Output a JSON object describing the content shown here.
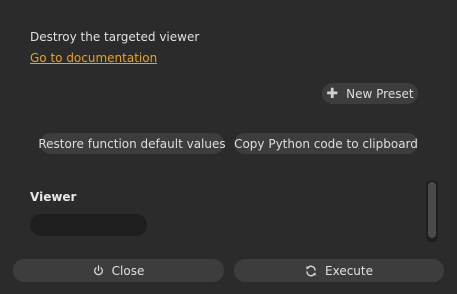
{
  "description": "Destroy the targeted viewer",
  "doc_link": "Go to documentation",
  "presets": {
    "new_label": "New Preset",
    "icon": "plus-icon"
  },
  "actions": {
    "restore_label": "Restore function default values",
    "copy_label": "Copy Python code to clipboard"
  },
  "parameters": {
    "viewer_label": "Viewer",
    "viewer_value": ""
  },
  "footer": {
    "close_label": "Close",
    "close_icon": "power-icon",
    "execute_label": "Execute",
    "execute_icon": "refresh-icon"
  },
  "colors": {
    "background": "#2b2b2b",
    "button": "#3d3d3d",
    "field": "#1e1e1e",
    "link": "#f0a30a"
  }
}
